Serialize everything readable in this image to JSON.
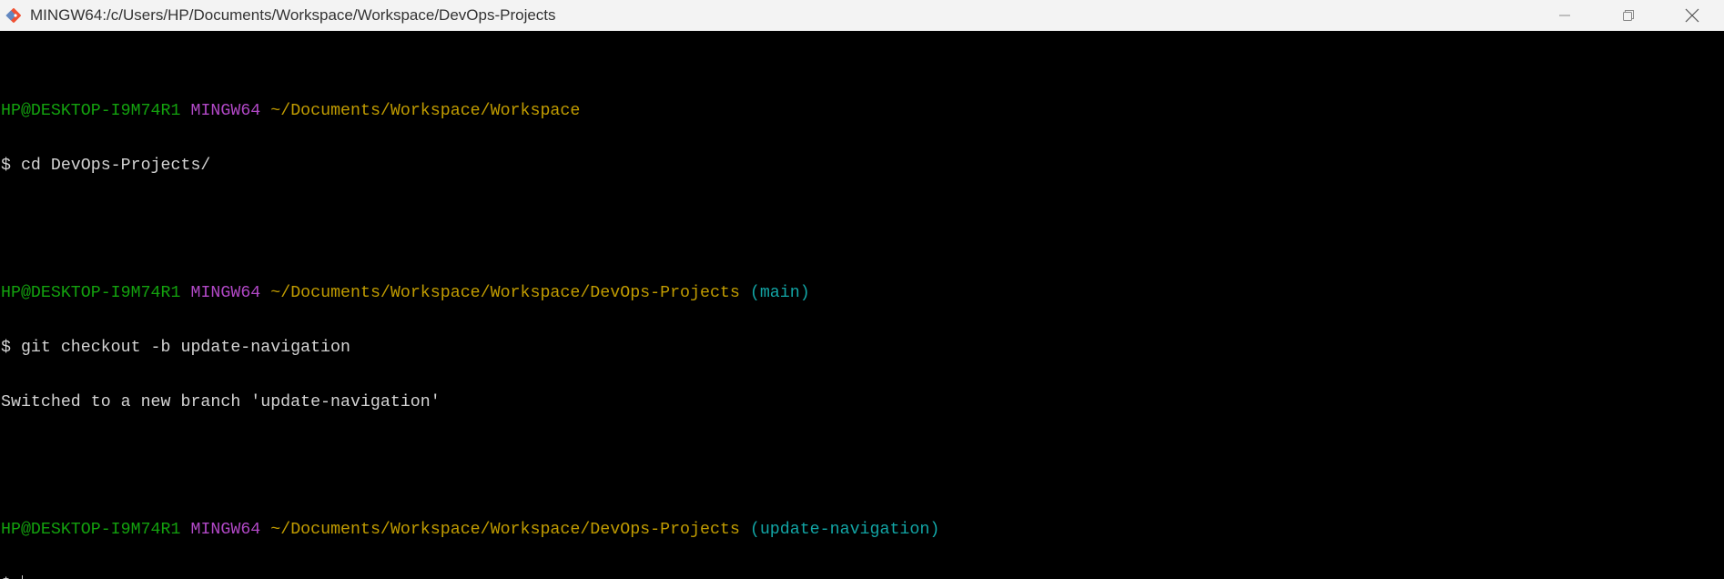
{
  "window": {
    "title": "MINGW64:/c/Users/HP/Documents/Workspace/Workspace/DevOps-Projects",
    "icon": "git-bash-icon",
    "controls": [
      "minimize-icon",
      "restore-icon",
      "close-icon"
    ]
  },
  "terminal": {
    "blocks": [
      {
        "prompt": {
          "user_host": "HP@DESKTOP-I9M74R1",
          "env": "MINGW64",
          "path": "~/Documents/Workspace/Workspace",
          "branch": ""
        },
        "command": "$ cd DevOps-Projects/",
        "output": ""
      },
      {
        "prompt": {
          "user_host": "HP@DESKTOP-I9M74R1",
          "env": "MINGW64",
          "path": "~/Documents/Workspace/Workspace/DevOps-Projects",
          "branch": "(main)"
        },
        "command": "$ git checkout -b update-navigation",
        "output": "Switched to a new branch 'update-navigation'"
      },
      {
        "prompt": {
          "user_host": "HP@DESKTOP-I9M74R1",
          "env": "MINGW64",
          "path": "~/Documents/Workspace/Workspace/DevOps-Projects",
          "branch": "(update-navigation)"
        },
        "command": "$ ",
        "output": ""
      }
    ]
  },
  "colors": {
    "background": "#000000",
    "user_host": "#13a10e",
    "env": "#b148c6",
    "path": "#c19c00",
    "branch": "#12a5a5",
    "text": "#d4d4d4"
  }
}
